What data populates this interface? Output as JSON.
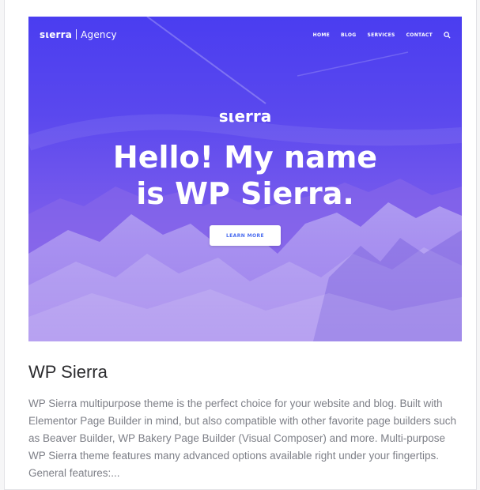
{
  "preview": {
    "logo": "sιerra",
    "logo_suffix": "Agency",
    "nav_items": [
      "HOME",
      "BLOG",
      "SERVICES",
      "CONTACT"
    ],
    "search_icon": "search-icon",
    "brand": "sιerra",
    "title_line1": "Hello! My name",
    "title_line2": "is WP Sierra.",
    "button_label": "LEARN MORE",
    "colors": {
      "overlay_top": "#4a3df0",
      "overlay_bottom": "#9a76ea",
      "button_text": "#4a6cf0"
    }
  },
  "card": {
    "title": "WP Sierra",
    "description": "WP Sierra multipurpose theme is the perfect choice for your website and blog. Built with Elementor Page Builder in mind, but also compatible with other favorite page builders such as Beaver Builder, WP Bakery Page Builder (Visual Composer) and more. Multi-purpose WP Sierra theme features many advanced options available right under your fingertips. General features:..."
  }
}
